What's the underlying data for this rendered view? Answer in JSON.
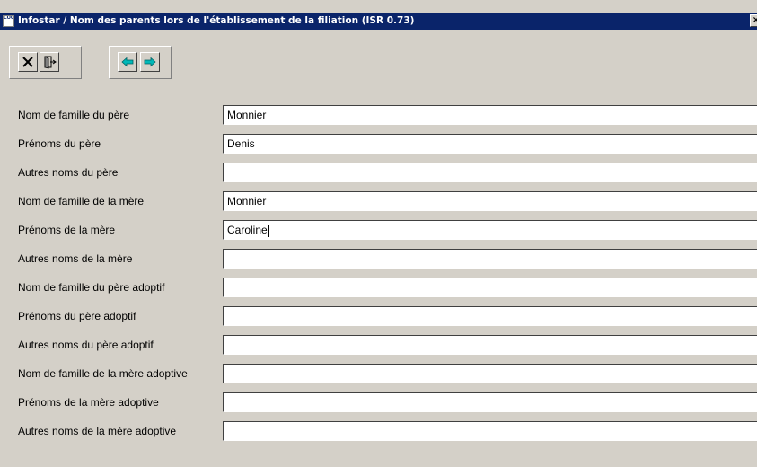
{
  "window": {
    "title": "Infostar / Nom des parents lors de l'établissement de la filiation (ISR 0.73)",
    "app_icon_label": "COOL GEN"
  },
  "toolbar": {
    "buttons": [
      {
        "name": "cancel-button",
        "icon": "x-icon"
      },
      {
        "name": "exit-button",
        "icon": "door-exit-icon"
      },
      {
        "name": "previous-button",
        "icon": "arrow-left-icon"
      },
      {
        "name": "next-button",
        "icon": "arrow-right-icon"
      }
    ]
  },
  "form": {
    "fields": [
      {
        "label": "Nom de famille du père",
        "value": "Monnier"
      },
      {
        "label": "Prénoms du père",
        "value": "Denis"
      },
      {
        "label": "Autres noms du père",
        "value": ""
      },
      {
        "label": "Nom de famille de la mère",
        "value": "Monnier"
      },
      {
        "label": "Prénoms de la mère",
        "value": "Caroline"
      },
      {
        "label": "Autres noms de la mère",
        "value": ""
      },
      {
        "label": "Nom de famille du père adoptif",
        "value": ""
      },
      {
        "label": "Prénoms du père adoptif",
        "value": ""
      },
      {
        "label": "Autres noms du père adoptif",
        "value": ""
      },
      {
        "label": "Nom de famille de la mère adoptive",
        "value": ""
      },
      {
        "label": "Prénoms de la mère adoptive",
        "value": ""
      },
      {
        "label": "Autres noms de la mère adoptive",
        "value": ""
      }
    ]
  },
  "colors": {
    "titlebar": "#0a246a",
    "window_bg": "#d4d0c8",
    "field_bg": "#ffffff",
    "arrow_icons": "#00a0a0"
  }
}
